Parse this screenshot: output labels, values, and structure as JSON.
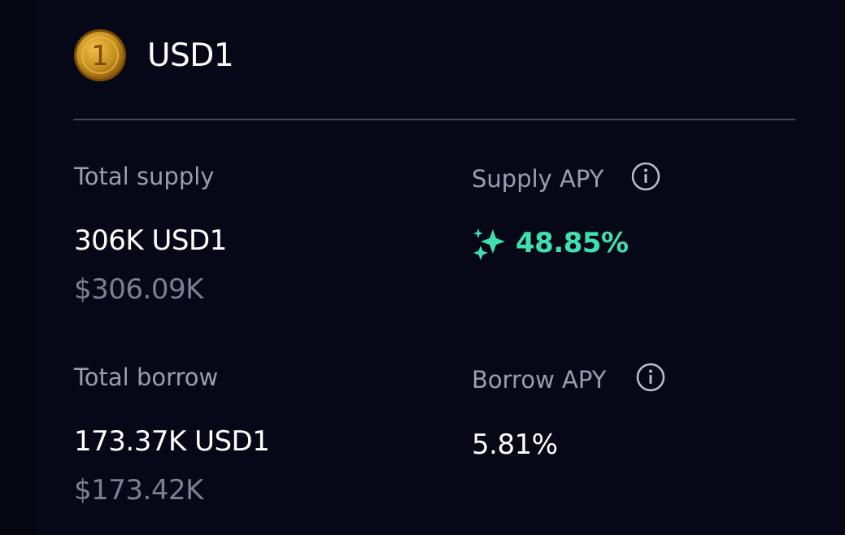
{
  "token": {
    "name": "USD1",
    "icon": "usd1-coin-icon",
    "icon_glyph": "1"
  },
  "supply": {
    "label": "Total supply",
    "amount": "306K USD1",
    "usd": "$306.09K"
  },
  "supply_apy": {
    "label": "Supply APY",
    "value": "48.85%",
    "icon": "sparkle-icon"
  },
  "borrow": {
    "label": "Total borrow",
    "amount": "173.37K USD1",
    "usd": "$173.42K"
  },
  "borrow_apy": {
    "label": "Borrow APY",
    "value": "5.81%"
  },
  "colors": {
    "background": "#06070f",
    "label": "#9a9daf",
    "value": "#ffffff",
    "usd": "#7c7f92",
    "accent_green": "#3ee0b0",
    "coin_gold": "#c8901d"
  }
}
